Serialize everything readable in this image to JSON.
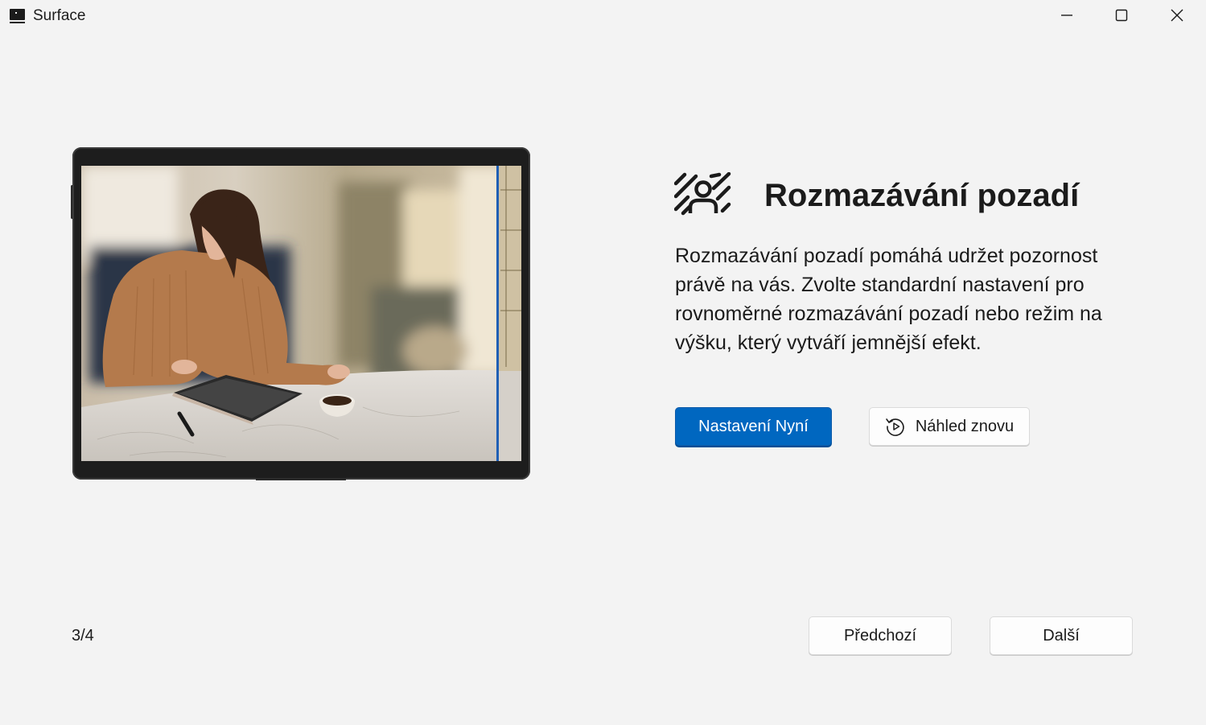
{
  "window": {
    "title": "Surface",
    "icons": {
      "app": "surface-app-icon",
      "minimize": "minimize-icon",
      "maximize": "maximize-icon",
      "close": "close-icon"
    }
  },
  "illustration": {
    "icon": "surface-device-photo-woman-with-tablet"
  },
  "feature": {
    "icon": "background-blur-icon",
    "title": "Rozmazávání pozadí",
    "description": "Rozmazávání pozadí pomáhá udržet pozornost právě na vás. Zvolte standardní nastavení pro rovnoměrné rozmazávání pozadí nebo režim na výšku, který vytváří jemnější efekt."
  },
  "actions": {
    "setup_now": "Nastavení Nyní",
    "replay": "Náhled znovu",
    "replay_icon": "replay-icon"
  },
  "navigation": {
    "page_indicator": "3/4",
    "previous": "Předchozí",
    "next": "Další"
  },
  "colors": {
    "accent": "#0067c0",
    "background": "#f3f3f3",
    "text": "#1b1b1b"
  }
}
